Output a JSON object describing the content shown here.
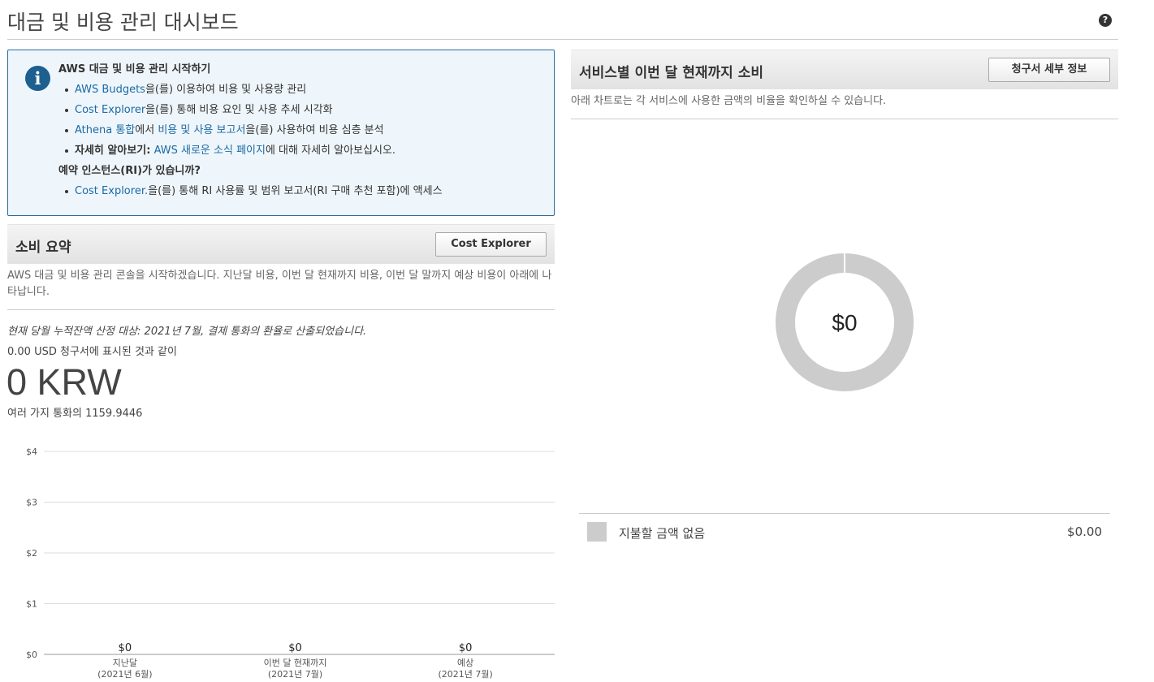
{
  "page": {
    "title": "대금 및 비용 관리 대시보드",
    "help_icon": "question-circle-icon"
  },
  "info_box": {
    "icon": "info-icon",
    "heading": "AWS 대금 및 비용 관리 시작하기",
    "items": [
      {
        "link": "AWS Budgets",
        "text": "을(를) 이용하여 비용 및 사용량 관리"
      },
      {
        "link": "Cost Explorer",
        "text": "을(를) 통해 비용 요인 및 사용 추세 시각화"
      },
      {
        "link1": "Athena 통합",
        "mid": "에서 ",
        "link2": "비용 및 사용 보고서",
        "text": "을(를) 사용하여 비용 심층 분석"
      },
      {
        "bold": "자세히 알아보기:",
        "link": "AWS 새로운 소식 페이지",
        "text": "에 대해 자세히 알아보십시오."
      }
    ],
    "ri_heading": "예약 인스턴스(RI)가 있습니까?",
    "ri_item": {
      "link": "Cost Explorer.",
      "text": "을(를) 통해 RI 사용률 및 범위 보고서(RI 구매 추천 포함)에 액세스"
    }
  },
  "spend_summary": {
    "title": "소비 요약",
    "button": "Cost Explorer",
    "description": "AWS 대금 및 비용 관리 콘솔을 시작하겠습니다. 지난달 비용, 이번 달 현재까지 비용, 이번 달 말까지 예상 비용이 아래에 나타납니다.",
    "note": "현재 당월 누적잔액 산정 대상: 2021년 7월, 결제 통화의 환율로 산출되었습니다.",
    "usd_line": "0.00 USD 청구서에 표시된 것과 같이",
    "total": "0 KRW",
    "rate_line": "여러 가지 통화의 1159.9446"
  },
  "by_service": {
    "title": "서비스별 이번 달 현재까지 소비",
    "button": "청구서 세부 정보",
    "description": "아래 차트로는 각 서비스에 사용한 금액의 비율을 확인하실 수 있습니다.",
    "legend": {
      "label": "지불할 금액 없음",
      "value": "$0.00",
      "color": "#cccccc"
    }
  },
  "chart_data": [
    {
      "type": "bar",
      "categories": [
        [
          "지난달",
          "(2021년 6월)"
        ],
        [
          "이번 달 현재까지",
          "(2021년 7월)"
        ],
        [
          "예상",
          "(2021년 7월)"
        ]
      ],
      "values": [
        0,
        0,
        0
      ],
      "data_labels": [
        "$0",
        "$0",
        "$0"
      ],
      "yticks": [
        "$0",
        "$1",
        "$2",
        "$3",
        "$4"
      ],
      "ylim": [
        0,
        4
      ],
      "grid": true
    },
    {
      "type": "pie",
      "style": "donut",
      "slices": [
        {
          "label": "지불할 금액 없음",
          "value": 0,
          "color": "#cccccc"
        }
      ],
      "center_label": "$0"
    }
  ]
}
